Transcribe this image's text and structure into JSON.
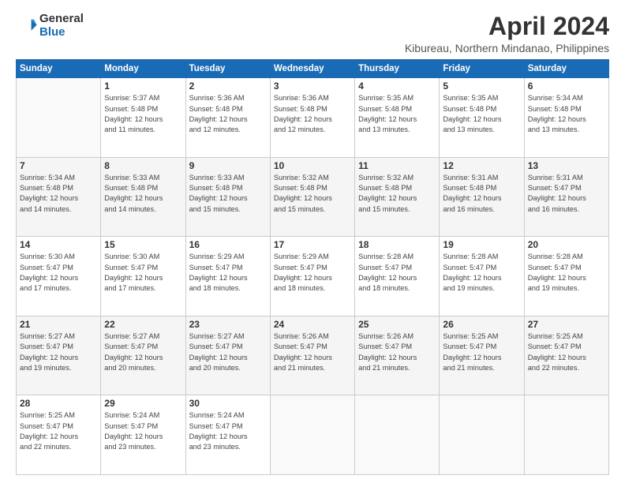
{
  "header": {
    "logo_general": "General",
    "logo_blue": "Blue",
    "title": "April 2024",
    "subtitle": "Kibureau, Northern Mindanao, Philippines"
  },
  "weekdays": [
    "Sunday",
    "Monday",
    "Tuesday",
    "Wednesday",
    "Thursday",
    "Friday",
    "Saturday"
  ],
  "weeks": [
    {
      "shade": false,
      "days": [
        {
          "num": "",
          "info": ""
        },
        {
          "num": "1",
          "info": "Sunrise: 5:37 AM\nSunset: 5:48 PM\nDaylight: 12 hours\nand 11 minutes."
        },
        {
          "num": "2",
          "info": "Sunrise: 5:36 AM\nSunset: 5:48 PM\nDaylight: 12 hours\nand 12 minutes."
        },
        {
          "num": "3",
          "info": "Sunrise: 5:36 AM\nSunset: 5:48 PM\nDaylight: 12 hours\nand 12 minutes."
        },
        {
          "num": "4",
          "info": "Sunrise: 5:35 AM\nSunset: 5:48 PM\nDaylight: 12 hours\nand 13 minutes."
        },
        {
          "num": "5",
          "info": "Sunrise: 5:35 AM\nSunset: 5:48 PM\nDaylight: 12 hours\nand 13 minutes."
        },
        {
          "num": "6",
          "info": "Sunrise: 5:34 AM\nSunset: 5:48 PM\nDaylight: 12 hours\nand 13 minutes."
        }
      ]
    },
    {
      "shade": true,
      "days": [
        {
          "num": "7",
          "info": "Sunrise: 5:34 AM\nSunset: 5:48 PM\nDaylight: 12 hours\nand 14 minutes."
        },
        {
          "num": "8",
          "info": "Sunrise: 5:33 AM\nSunset: 5:48 PM\nDaylight: 12 hours\nand 14 minutes."
        },
        {
          "num": "9",
          "info": "Sunrise: 5:33 AM\nSunset: 5:48 PM\nDaylight: 12 hours\nand 15 minutes."
        },
        {
          "num": "10",
          "info": "Sunrise: 5:32 AM\nSunset: 5:48 PM\nDaylight: 12 hours\nand 15 minutes."
        },
        {
          "num": "11",
          "info": "Sunrise: 5:32 AM\nSunset: 5:48 PM\nDaylight: 12 hours\nand 15 minutes."
        },
        {
          "num": "12",
          "info": "Sunrise: 5:31 AM\nSunset: 5:48 PM\nDaylight: 12 hours\nand 16 minutes."
        },
        {
          "num": "13",
          "info": "Sunrise: 5:31 AM\nSunset: 5:47 PM\nDaylight: 12 hours\nand 16 minutes."
        }
      ]
    },
    {
      "shade": false,
      "days": [
        {
          "num": "14",
          "info": "Sunrise: 5:30 AM\nSunset: 5:47 PM\nDaylight: 12 hours\nand 17 minutes."
        },
        {
          "num": "15",
          "info": "Sunrise: 5:30 AM\nSunset: 5:47 PM\nDaylight: 12 hours\nand 17 minutes."
        },
        {
          "num": "16",
          "info": "Sunrise: 5:29 AM\nSunset: 5:47 PM\nDaylight: 12 hours\nand 18 minutes."
        },
        {
          "num": "17",
          "info": "Sunrise: 5:29 AM\nSunset: 5:47 PM\nDaylight: 12 hours\nand 18 minutes."
        },
        {
          "num": "18",
          "info": "Sunrise: 5:28 AM\nSunset: 5:47 PM\nDaylight: 12 hours\nand 18 minutes."
        },
        {
          "num": "19",
          "info": "Sunrise: 5:28 AM\nSunset: 5:47 PM\nDaylight: 12 hours\nand 19 minutes."
        },
        {
          "num": "20",
          "info": "Sunrise: 5:28 AM\nSunset: 5:47 PM\nDaylight: 12 hours\nand 19 minutes."
        }
      ]
    },
    {
      "shade": true,
      "days": [
        {
          "num": "21",
          "info": "Sunrise: 5:27 AM\nSunset: 5:47 PM\nDaylight: 12 hours\nand 19 minutes."
        },
        {
          "num": "22",
          "info": "Sunrise: 5:27 AM\nSunset: 5:47 PM\nDaylight: 12 hours\nand 20 minutes."
        },
        {
          "num": "23",
          "info": "Sunrise: 5:27 AM\nSunset: 5:47 PM\nDaylight: 12 hours\nand 20 minutes."
        },
        {
          "num": "24",
          "info": "Sunrise: 5:26 AM\nSunset: 5:47 PM\nDaylight: 12 hours\nand 21 minutes."
        },
        {
          "num": "25",
          "info": "Sunrise: 5:26 AM\nSunset: 5:47 PM\nDaylight: 12 hours\nand 21 minutes."
        },
        {
          "num": "26",
          "info": "Sunrise: 5:25 AM\nSunset: 5:47 PM\nDaylight: 12 hours\nand 21 minutes."
        },
        {
          "num": "27",
          "info": "Sunrise: 5:25 AM\nSunset: 5:47 PM\nDaylight: 12 hours\nand 22 minutes."
        }
      ]
    },
    {
      "shade": false,
      "days": [
        {
          "num": "28",
          "info": "Sunrise: 5:25 AM\nSunset: 5:47 PM\nDaylight: 12 hours\nand 22 minutes."
        },
        {
          "num": "29",
          "info": "Sunrise: 5:24 AM\nSunset: 5:47 PM\nDaylight: 12 hours\nand 23 minutes."
        },
        {
          "num": "30",
          "info": "Sunrise: 5:24 AM\nSunset: 5:47 PM\nDaylight: 12 hours\nand 23 minutes."
        },
        {
          "num": "",
          "info": ""
        },
        {
          "num": "",
          "info": ""
        },
        {
          "num": "",
          "info": ""
        },
        {
          "num": "",
          "info": ""
        }
      ]
    }
  ]
}
